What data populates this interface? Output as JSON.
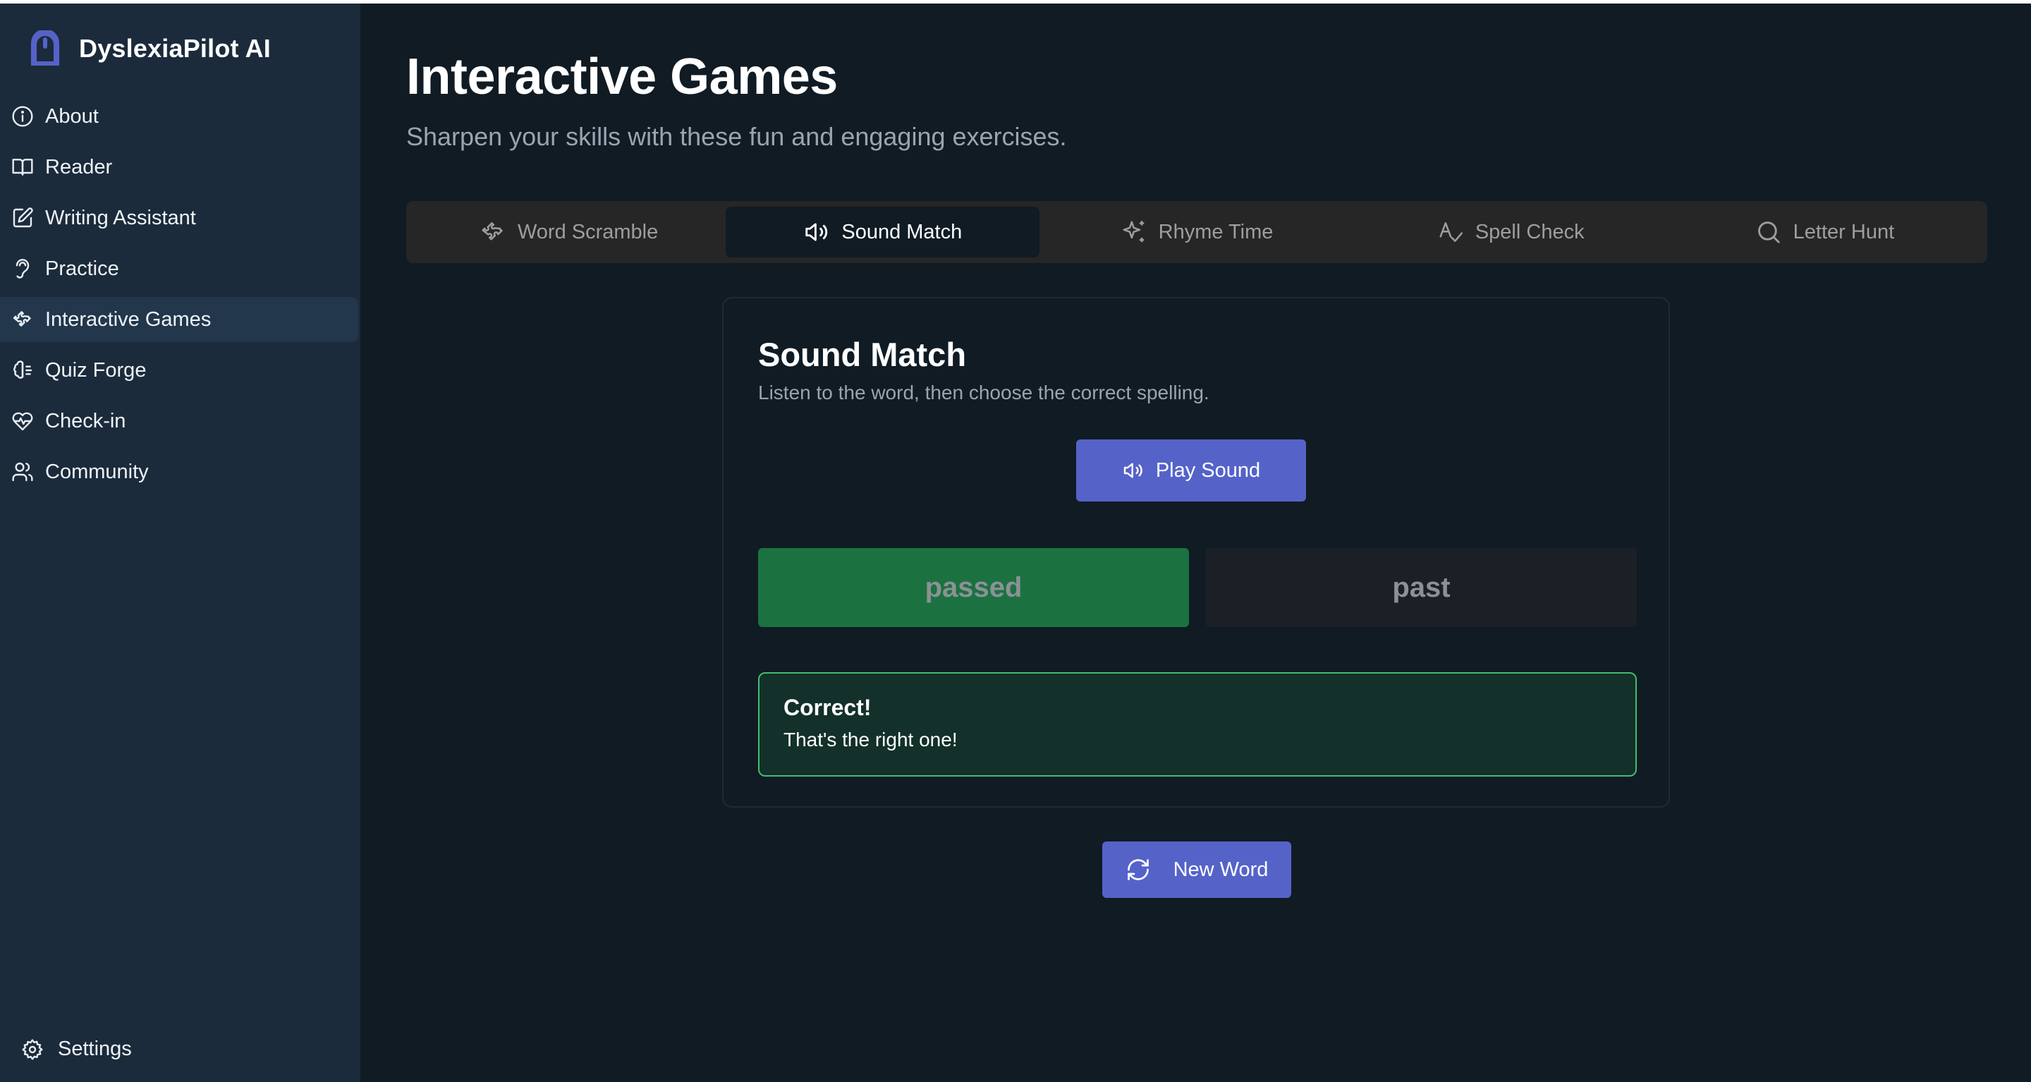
{
  "app": {
    "name": "DyslexiaPilot AI",
    "logo_icon": "arch-logo-icon",
    "accent_color": "#5563c9"
  },
  "sidebar": {
    "items": [
      {
        "label": "About",
        "icon": "info-icon",
        "active": false
      },
      {
        "label": "Reader",
        "icon": "book-open-icon",
        "active": false
      },
      {
        "label": "Writing Assistant",
        "icon": "pencil-square-icon",
        "active": false
      },
      {
        "label": "Practice",
        "icon": "ear-icon",
        "active": false
      },
      {
        "label": "Interactive Games",
        "icon": "puzzle-icon",
        "active": true
      },
      {
        "label": "Quiz Forge",
        "icon": "brain-icon",
        "active": false
      },
      {
        "label": "Check-in",
        "icon": "heart-pulse-icon",
        "active": false
      },
      {
        "label": "Community",
        "icon": "users-icon",
        "active": false
      }
    ],
    "settings": {
      "label": "Settings",
      "icon": "gear-icon"
    }
  },
  "main": {
    "title": "Interactive Games",
    "subtitle": "Sharpen your skills with these fun and engaging exercises.",
    "tabs": [
      {
        "label": "Word Scramble",
        "icon": "puzzle-icon",
        "active": false
      },
      {
        "label": "Sound Match",
        "icon": "speaker-icon",
        "active": true
      },
      {
        "label": "Rhyme Time",
        "icon": "sparkles-icon",
        "active": false
      },
      {
        "label": "Spell Check",
        "icon": "spell-check-icon",
        "active": false
      },
      {
        "label": "Letter Hunt",
        "icon": "search-icon",
        "active": false
      }
    ]
  },
  "game": {
    "title": "Sound Match",
    "description": "Listen to the word, then choose the correct spelling.",
    "play_button": "Play Sound",
    "choices": [
      {
        "label": "passed",
        "state": "correct"
      },
      {
        "label": "past",
        "state": "unselected"
      }
    ],
    "feedback": {
      "title": "Correct!",
      "message": "That's the right one!",
      "color": "#3fbf6e"
    },
    "new_word_button": "New Word"
  }
}
